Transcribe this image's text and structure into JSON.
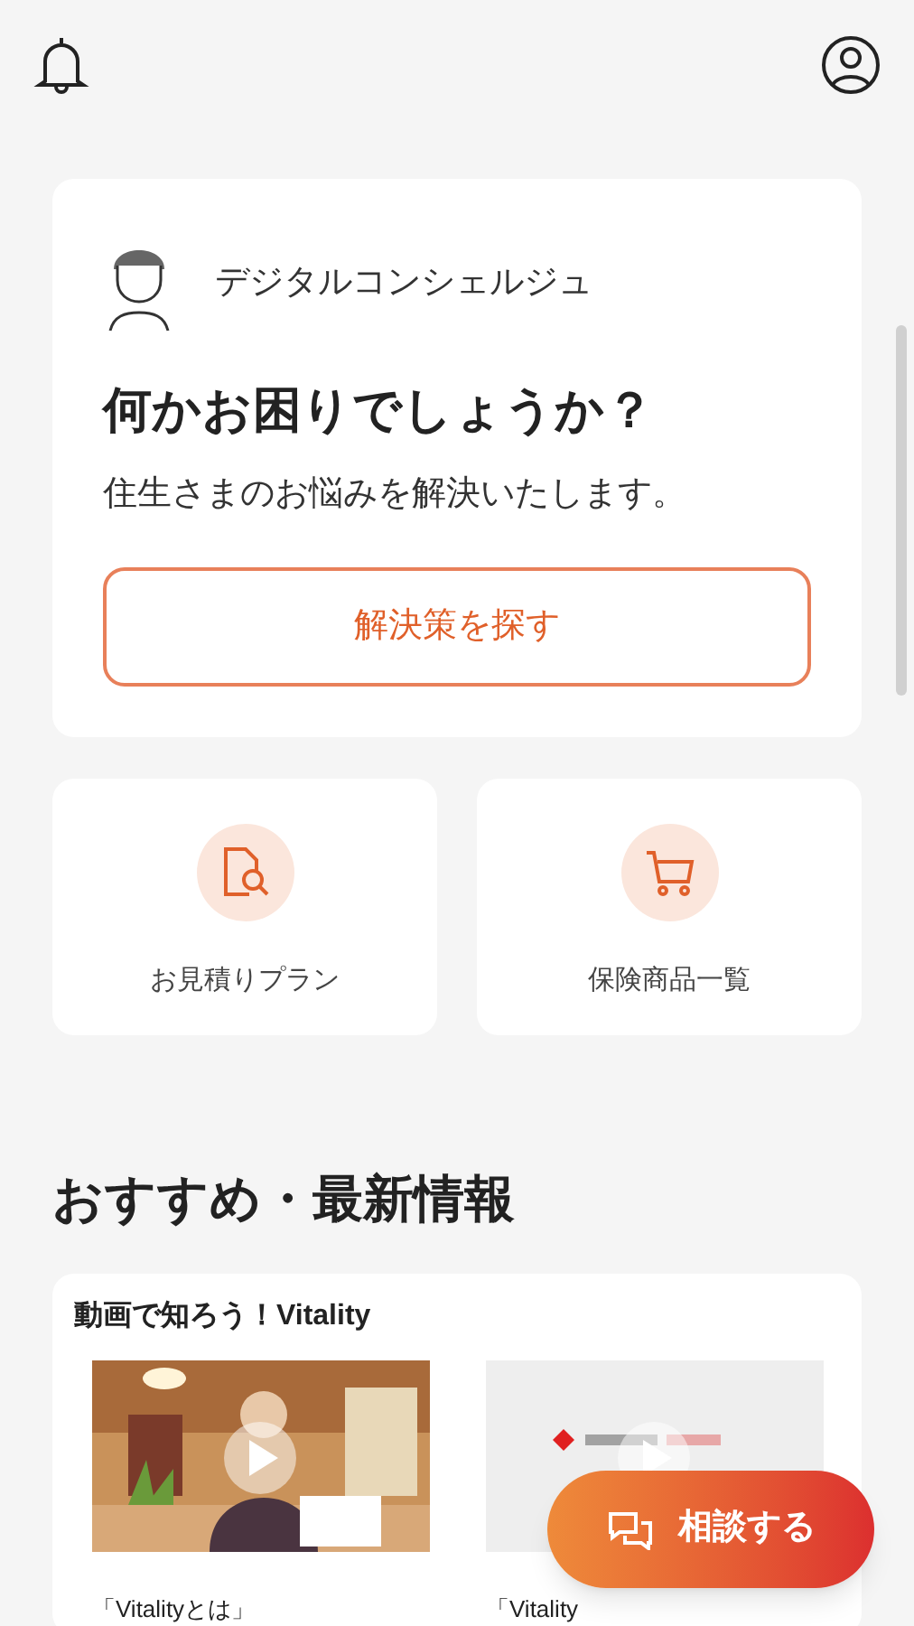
{
  "concierge": {
    "name": "デジタルコンシェルジュ",
    "title": "何かお困りでしょうか？",
    "message": "住生さまのお悩みを解決いたします。",
    "button": "解決策を探す"
  },
  "shortcuts": [
    {
      "kind": "estimate",
      "label": "お見積りプラン"
    },
    {
      "kind": "cart",
      "label": "保険商品一覧"
    }
  ],
  "recommend": {
    "heading": "おすすめ・最新情報",
    "section_title": "動画で知ろう！Vitality",
    "videos": [
      {
        "kind": "office",
        "caption": "「Vitalityとは」"
      },
      {
        "kind": "logo",
        "caption": "「Vitality"
      }
    ]
  },
  "fab": {
    "label": "相談する"
  }
}
